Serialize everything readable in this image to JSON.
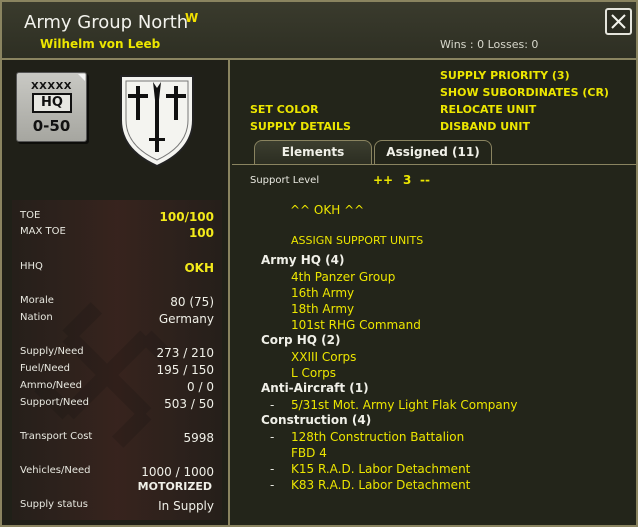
{
  "header": {
    "unit_name": "Army Group North",
    "flag": "W",
    "commander": "Wilhelm von Leeb",
    "record": "Wins : 0  Losses: 0"
  },
  "counter": {
    "size": "XXXXX",
    "type": "HQ",
    "value": "0-50"
  },
  "insignia": {
    "icon": "shield-crosses-sword-icon"
  },
  "stats": [
    {
      "label": "TOE",
      "value": "100/100"
    },
    {
      "label": "MAX TOE",
      "value": "100"
    },
    {
      "label": "HHQ",
      "value": "OKH"
    },
    {
      "label": "Morale",
      "value": "80 (75)"
    },
    {
      "label": "Nation",
      "value": "Germany"
    },
    {
      "label": "Supply/Need",
      "value": "273 / 210"
    },
    {
      "label": "Fuel/Need",
      "value": "195 / 150"
    },
    {
      "label": "Ammo/Need",
      "value": "0 / 0"
    },
    {
      "label": "Support/Need",
      "value": "503 / 50"
    },
    {
      "label": "Transport Cost",
      "value": "5998"
    },
    {
      "label": "Vehicles/Need",
      "value": "1000 / 1000"
    },
    {
      "label": "Supply status",
      "value": "In Supply"
    }
  ],
  "vehicle_mode": "MOTORIZED",
  "actions": {
    "supply_priority": "SUPPLY PRIORITY (3)",
    "show_subordinates": "SHOW SUBORDINATES (CR)",
    "set_color": "SET COLOR",
    "relocate_unit": "RELOCATE UNIT",
    "supply_details": "SUPPLY DETAILS",
    "disband_unit": "DISBAND UNIT"
  },
  "tabs": [
    {
      "label": "Elements",
      "active": false
    },
    {
      "label": "Assigned (11)",
      "active": true
    }
  ],
  "support": {
    "label": "Support Level",
    "increase": "++",
    "value": "3",
    "decrease": "--"
  },
  "hq_link": "^^  OKH  ^^",
  "assign_support": "ASSIGN SUPPORT UNITS",
  "groups": [
    {
      "title": "Army HQ (4)",
      "items": [
        {
          "dash": "",
          "name": "4th Panzer Group"
        },
        {
          "dash": "",
          "name": "16th Army"
        },
        {
          "dash": "",
          "name": "18th Army"
        },
        {
          "dash": "",
          "name": "101st RHG Command"
        }
      ]
    },
    {
      "title": "Corp HQ (2)",
      "items": [
        {
          "dash": "",
          "name": "XXIII Corps"
        },
        {
          "dash": "",
          "name": "L Corps"
        }
      ]
    },
    {
      "title": "Anti-Aircraft (1)",
      "items": [
        {
          "dash": "-",
          "name": "5/31st Mot. Army Light Flak Company"
        }
      ]
    },
    {
      "title": "Construction (4)",
      "items": [
        {
          "dash": "-",
          "name": "128th Construction Battalion"
        },
        {
          "dash": "",
          "name": "FBD 4"
        },
        {
          "dash": "-",
          "name": "K15 R.A.D. Labor Detachment"
        },
        {
          "dash": "-",
          "name": "K83 R.A.D. Labor Detachment"
        }
      ]
    }
  ]
}
